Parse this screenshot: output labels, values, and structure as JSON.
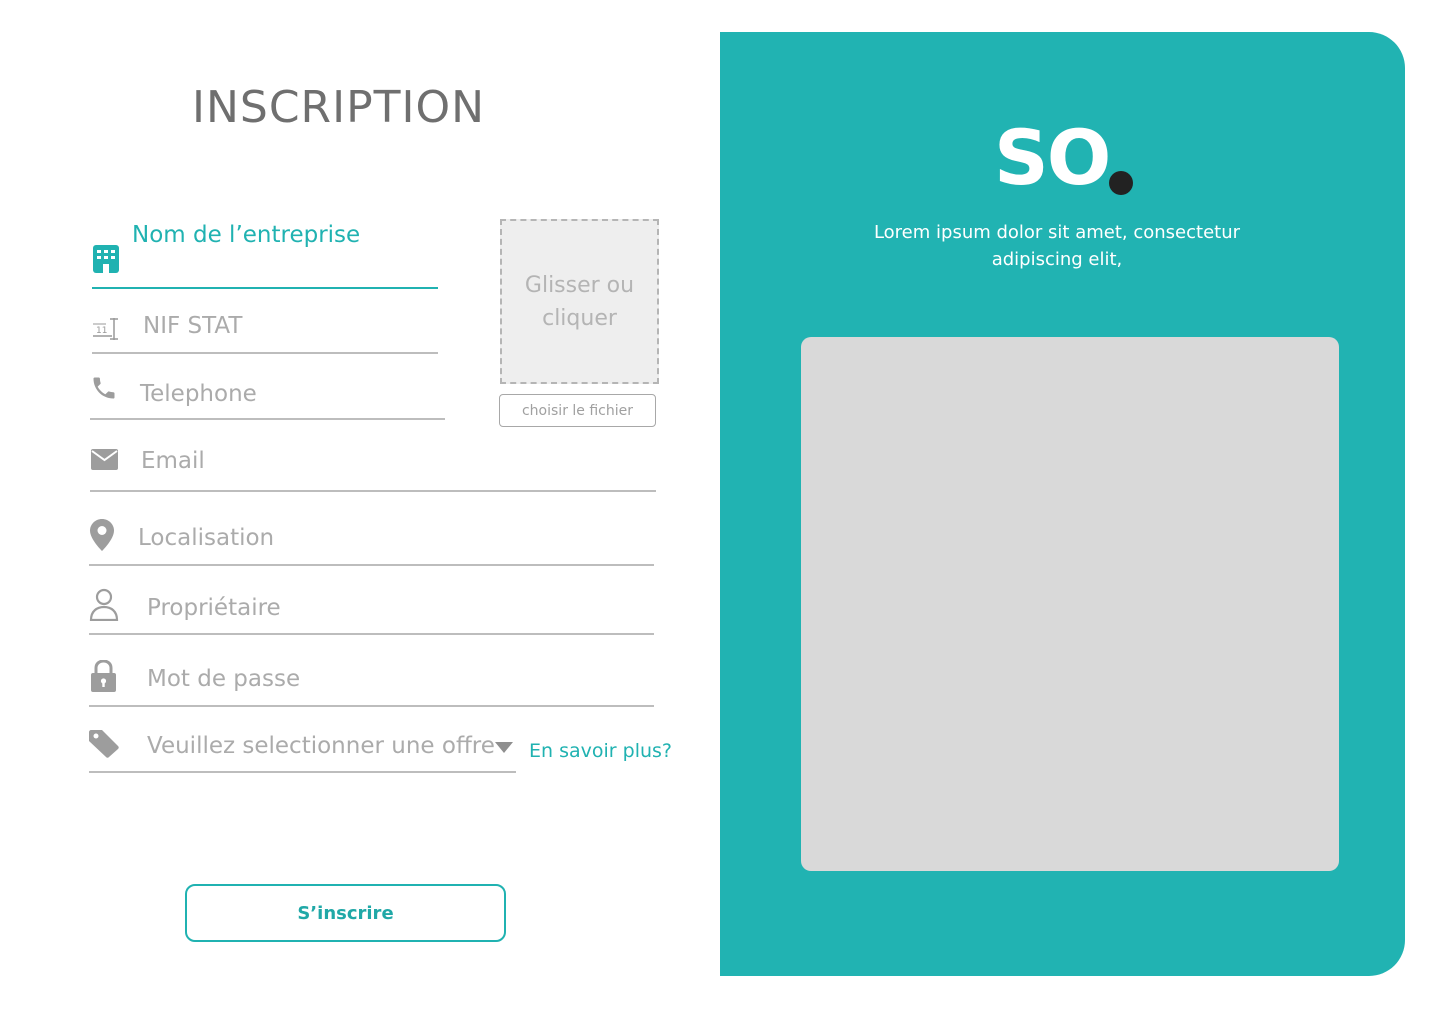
{
  "form": {
    "title": "INSCRIPTION",
    "fields": {
      "company": {
        "label": "Nom de l’entreprise",
        "icon": "building-icon"
      },
      "nif": {
        "label": "NIF STAT",
        "icon": "id-number-icon"
      },
      "phone": {
        "label": "Telephone",
        "icon": "phone-icon"
      },
      "email": {
        "label": "Email",
        "icon": "envelope-icon"
      },
      "location": {
        "label": "Localisation",
        "icon": "map-pin-icon"
      },
      "owner": {
        "label": "Propriétaire",
        "icon": "user-icon"
      },
      "password": {
        "label": "Mot de passe",
        "icon": "lock-icon"
      },
      "offer": {
        "label": "Veuillez selectionner une offre",
        "icon": "tag-icon"
      }
    },
    "upload": {
      "drop_text": "Glisser  ou cliquer",
      "button_label": "choisir le fichier"
    },
    "learn_more": "En savoir plus?",
    "submit_label": "S’inscrire"
  },
  "brand": {
    "logo": "SO",
    "tagline": "Lorem ipsum dolor sit amet, consectetur adipiscing elit,"
  },
  "colors": {
    "accent": "#21b3b2",
    "muted": "#ababab",
    "dot": "#222222",
    "image_placeholder": "#d9d9d9"
  }
}
